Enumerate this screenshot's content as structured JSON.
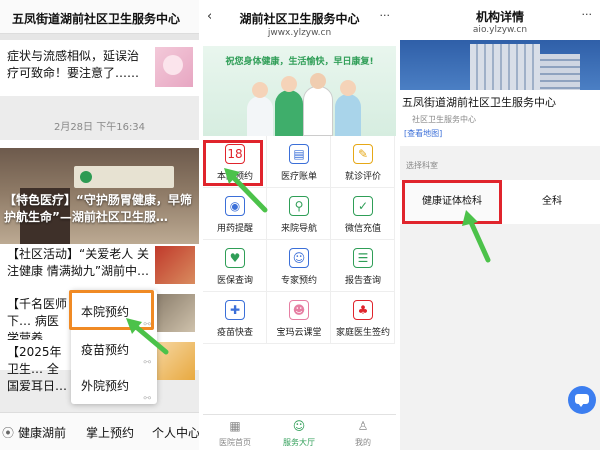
{
  "panel1": {
    "header_title": "五凤街道湖前社区卫生服务中心",
    "card1_text": "症状与流感相似，延误治疗可致命！要注意了……",
    "date": "2月28日 下午16:34",
    "hero_caption": "【特色医疗】“守护肠胃健康，早筛护航生命”—湖前社区卫生服…",
    "items": [
      {
        "text": "【社区活动】“关爱老人 关注健康 情满拗九”湖前中…"
      },
      {
        "text": "【千名医师下… 病医学营养…"
      },
      {
        "text": "【2025年卫生… 全国爱耳日…"
      }
    ],
    "popup": [
      {
        "label": "本院预约"
      },
      {
        "label": "疫苗预约"
      },
      {
        "label": "外院预约"
      }
    ],
    "bottom_menu": [
      "健康湖前",
      "掌上预约",
      "个人中心"
    ]
  },
  "panel2": {
    "title": "湖前社区卫生服务中心",
    "url": "jwwx.ylzyw.cn",
    "back_icon": "‹",
    "more_icon": "···",
    "slogan": "祝您身体健康，生活愉快，早日康复!",
    "grid": [
      {
        "label": "本院预约",
        "icon": "calendar-icon",
        "glyph": "18",
        "color": "#e0242c"
      },
      {
        "label": "医疗账单",
        "icon": "bill-icon",
        "glyph": "▤",
        "color": "#3b6fd8"
      },
      {
        "label": "就诊评价",
        "icon": "comment-icon",
        "glyph": "✎",
        "color": "#e6a817"
      },
      {
        "label": "用药提醒",
        "icon": "pill-icon",
        "glyph": "◉",
        "color": "#3b6fd8"
      },
      {
        "label": "来院导航",
        "icon": "location-icon",
        "glyph": "⚲",
        "color": "#2f9e57"
      },
      {
        "label": "微信充值",
        "icon": "check-icon",
        "glyph": "✓",
        "color": "#2f9e57"
      },
      {
        "label": "医保查询",
        "icon": "insurance-icon",
        "glyph": "♥",
        "color": "#2f9e57"
      },
      {
        "label": "专家预约",
        "icon": "doctor-icon",
        "glyph": "☺",
        "color": "#3b6fd8"
      },
      {
        "label": "报告查询",
        "icon": "report-icon",
        "glyph": "☰",
        "color": "#2f9e57"
      },
      {
        "label": "疫苗快查",
        "icon": "syringe-icon",
        "glyph": "✚",
        "color": "#3b6fd8"
      },
      {
        "label": "宝玛云课堂",
        "icon": "baby-icon",
        "glyph": "☻",
        "color": "#e67fa3"
      },
      {
        "label": "家庭医生签约",
        "icon": "family-icon",
        "glyph": "♣",
        "color": "#e0242c"
      }
    ],
    "tabs": [
      {
        "label": "医院首页",
        "icon": "hospital-icon",
        "glyph": "▦",
        "color": "#888888"
      },
      {
        "label": "服务大厅",
        "icon": "service-icon",
        "glyph": "☺",
        "color": "#2f9e57"
      },
      {
        "label": "我的",
        "icon": "user-icon",
        "glyph": "♙",
        "color": "#888888"
      }
    ]
  },
  "panel3": {
    "title": "机构详情",
    "url": "aio.ylzyw.cn",
    "more_icon": "···",
    "inst_name": "五凤街道湖前社区卫生服务中心",
    "inst_addr": "社区卫生服务中心",
    "map_link": "[查看地图]",
    "dept_label": "选择科室",
    "depts": [
      "健康证体检科",
      "全科"
    ]
  },
  "colors": {
    "accent_green": "#2f9e57",
    "highlight_red": "#e0242c",
    "highlight_orange": "#f08a24",
    "link_blue": "#3b6fd8"
  }
}
